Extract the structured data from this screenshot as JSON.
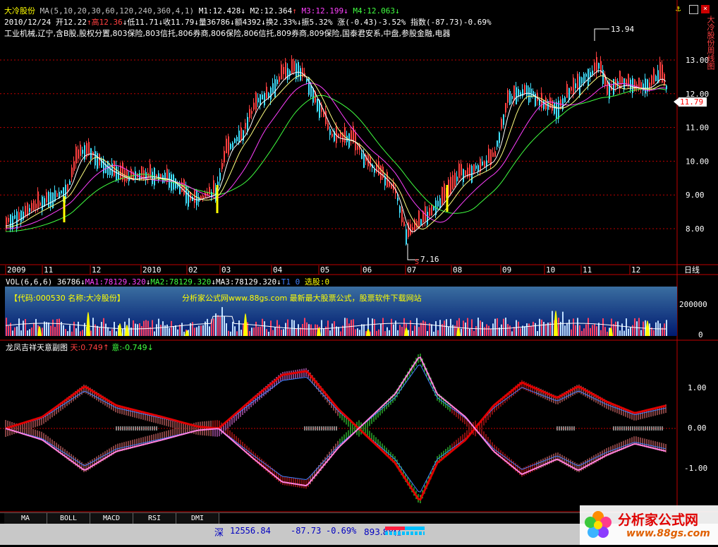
{
  "header": {
    "stock_name": "大冷股份",
    "ma_label": "MA(5,10,20,30,60,120,240,360,4,1)",
    "m1": "M1:12.428",
    "m2": "M2:12.364",
    "m3": "M3:12.199",
    "m4": "M4:12.063",
    "date": "2010/12/24",
    "open": "开12.22",
    "high": "高12.36",
    "low": "低11.71",
    "close": "收11.79",
    "volume": "量36786",
    "amount": "额4392",
    "turnover": "换2.33%",
    "amplitude": "振5.32%",
    "change": "涨(-0.43)-3.52%",
    "index": "指数(-87.73)-0.69%",
    "sectors": "工业机械,辽宁,含B股,股权分置,803保险,803信托,806券商,806保险,806信托,809券商,809保险,国泰君安系,中盘,参股金融,电器"
  },
  "price_panel": {
    "y_ticks": [
      "13.00",
      "12.00",
      "11.00",
      "10.00",
      "9.00",
      "8.00"
    ],
    "current_price": "11.79",
    "max_label": "13.94",
    "min_label": "7.16",
    "right_vertical_text": "大冷股份周线图"
  },
  "time_axis": {
    "labels": [
      "2009",
      "11",
      "12",
      "2010",
      "02",
      "03",
      "04",
      "05",
      "06",
      "07",
      "08",
      "09",
      "10",
      "11",
      "12"
    ],
    "period": "日线"
  },
  "vol_panel": {
    "title": "VOL(6,6,6)",
    "value": "36786",
    "ma1": "MA1:78129.320",
    "ma2": "MA2:78129.320",
    "ma3": "MA3:78129.320",
    "t1": "T1 0",
    "select": "选股:0",
    "banner_code": "【代码:000530 名称:大冷股份】",
    "banner_site": "分析家公式网www.88gs.com 最新最大股票公式，股票软件下载网站",
    "y_ticks": [
      "200000",
      "0"
    ]
  },
  "indicator_panel": {
    "title": "龙凤吉祥天意副图",
    "tian": "天:0.749",
    "yi": "意:-0.749",
    "y_ticks": [
      "1.00",
      "0.00",
      "-1.00"
    ]
  },
  "tabs": [
    "MA",
    "BOLL",
    "MACD",
    "RSI",
    "DMI"
  ],
  "status": {
    "market": "深",
    "index_value": "12556.84",
    "change": "-87.73",
    "pct": "-0.69%",
    "amount": "893.88亿"
  },
  "watermark": {
    "brand": "分析家公式网",
    "url": "www.88gs.com"
  },
  "colors": {
    "up": "#ff4040",
    "down": "#40e0ff",
    "ma5": "#ffffff",
    "ma10": "#ffff80",
    "ma20": "#ff40ff",
    "ma30": "#40ff40",
    "axis": "#c00000"
  }
}
